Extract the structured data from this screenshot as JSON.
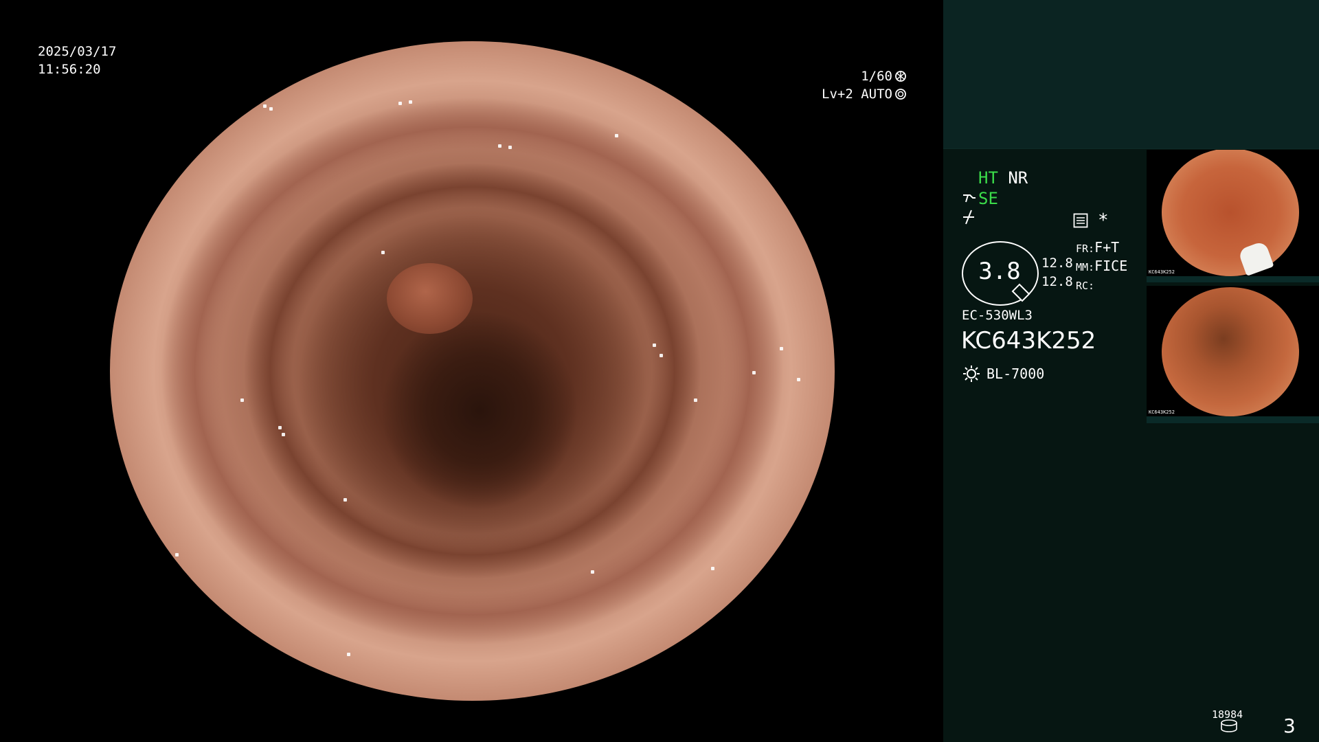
{
  "overlay": {
    "date": "2025/03/17",
    "time": "11:56:20",
    "shutter": "1/60",
    "level": "Lv+2 AUTO"
  },
  "panel": {
    "ht": "HT",
    "nr": "NR",
    "se": "SE",
    "asterisk": "*",
    "gauge_value": "3.8",
    "val_top": "12.8",
    "val_bottom": "12.8",
    "fr_label": "FR:",
    "fr_value": "F+T",
    "mm_label": "MM:",
    "mm_value": "FICE",
    "rc_label": "RC:",
    "scope_model": "EC-530WL3",
    "serial": "KC643K252",
    "light_source": "BL-7000",
    "counter": "18984",
    "page": "3"
  },
  "thumbnails": [
    {
      "caption": "KC643K252"
    },
    {
      "caption": "KC643K252"
    }
  ],
  "icons": {
    "shutter": "shutter-icon",
    "iris": "iris-icon",
    "tool": "tool-icon",
    "flash": "flash-icon",
    "menu": "menu-icon",
    "light": "light-icon",
    "storage": "storage-icon"
  }
}
